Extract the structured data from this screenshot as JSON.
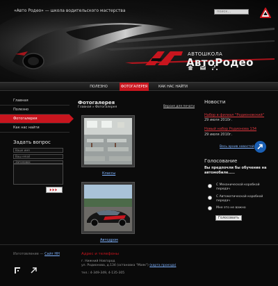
{
  "header": {
    "tagline": "«Авто Родео» — школа водительского мастерства",
    "search_placeholder": "поиск...",
    "logo_small": "АВТОШКОЛА",
    "logo_big": "АвтоРодео"
  },
  "nav": {
    "items": [
      {
        "label": "ПОЛЕЗНО",
        "active": false
      },
      {
        "label": "ФОТОГАЛЕРЕЯ",
        "active": true
      },
      {
        "label": "КАК НАС НАЙТИ",
        "active": false
      }
    ]
  },
  "sidebar": {
    "items": [
      {
        "label": "Главная",
        "active": false
      },
      {
        "label": "Полезно",
        "active": false
      },
      {
        "label": "Фотогалерея",
        "active": true
      },
      {
        "label": "Как нас найти",
        "active": false
      }
    ],
    "ask_title": "Задать вопрос",
    "fields": [
      "Ваше имя",
      "Ваш email",
      "Заголовок"
    ]
  },
  "main": {
    "title": "Фотогалерея",
    "breadcrumb": "Главная » Фотогалерея",
    "print_link": "Версия для печати",
    "photos": [
      {
        "caption": "Классы"
      },
      {
        "caption": "Автодром"
      }
    ]
  },
  "news": {
    "title": "Новости",
    "items": [
      {
        "link": "Набор в филиал \"Родионовский\"",
        "date": "29 июля 2010г."
      },
      {
        "link": "Новый набор Родионова 134",
        "date": "29 июля 2010г."
      }
    ],
    "all_link": "Весь архив новостей"
  },
  "poll": {
    "title": "Голосование",
    "question": "Вы предпочли бы обучение на автомобиле.....",
    "options": [
      "С Механической коробкой передач",
      "С Автоматической коробкой передач",
      "Мне это не важно"
    ],
    "vote_label": "Голосовать"
  },
  "footer": {
    "made_prefix": "Изготовление — ",
    "made_link": "Сайт НН",
    "addr_title": "Адрес и телефоны",
    "addr_city": "г. Нижний Новгород",
    "addr_street": "ул. Родионова, д.134 (остановка \"Маяк\")",
    "map_link": "(карта проезда)",
    "phones": "тел.: 4-349-349, 4-135-305"
  },
  "colors": {
    "accent_red": "#c8151e",
    "link_blue": "#7fb3ff",
    "news_red": "#e0383f"
  }
}
